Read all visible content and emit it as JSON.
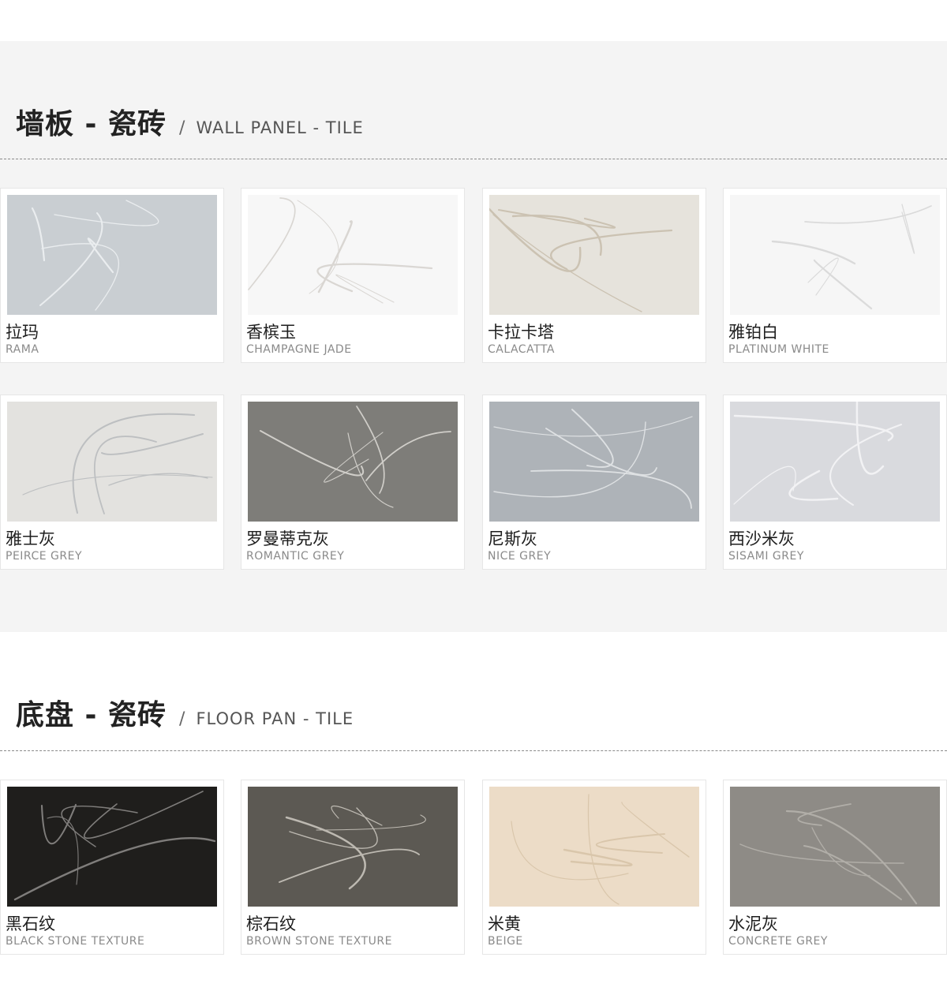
{
  "wall": {
    "title_cn": "墙板 - 瓷砖",
    "slash": "/",
    "title_en": "WALL PANEL - TILE",
    "tiles": [
      {
        "cn": "拉玛",
        "en": "RAMA",
        "bg": "#c9ced2",
        "vein": "#eef1f3"
      },
      {
        "cn": "香槟玉",
        "en": "CHAMPAGNE JADE",
        "bg": "#f7f7f7",
        "vein": "#d6d3cf"
      },
      {
        "cn": "卡拉卡塔",
        "en": "CALACATTA",
        "bg": "#e6e3dc",
        "vein": "#c9bfae"
      },
      {
        "cn": "雅铂白",
        "en": "PLATINUM WHITE",
        "bg": "#f6f6f6",
        "vein": "#d8d8d8"
      },
      {
        "cn": "雅士灰",
        "en": "PEIRCE GREY",
        "bg": "#e3e2df",
        "vein": "#b9bcbe"
      },
      {
        "cn": "罗曼蒂克灰",
        "en": "ROMANTIC GREY",
        "bg": "#7e7d79",
        "vein": "#d9d7d2"
      },
      {
        "cn": "尼斯灰",
        "en": "NICE GREY",
        "bg": "#aeb3b8",
        "vein": "#e4e6e8"
      },
      {
        "cn": "西沙米灰",
        "en": "SISAMI GREY",
        "bg": "#d9dade",
        "vein": "#f5f5f7"
      }
    ]
  },
  "floor": {
    "title_cn": "底盘 - 瓷砖",
    "slash": "/",
    "title_en": "FLOOR PAN - TILE",
    "tiles": [
      {
        "cn": "黑石纹",
        "en": "BLACK STONE TEXTURE",
        "bg": "#1f1e1c",
        "vein": "#8a8886"
      },
      {
        "cn": "棕石纹",
        "en": "BROWN STONE TEXTURE",
        "bg": "#5c5953",
        "vein": "#c8c4bc"
      },
      {
        "cn": "米黄",
        "en": "BEIGE",
        "bg": "#ecdcc7",
        "vein": "#d8c4a8"
      },
      {
        "cn": "水泥灰",
        "en": "CONCRETE GREY",
        "bg": "#8e8b86",
        "vein": "#b5b2ac"
      }
    ]
  }
}
